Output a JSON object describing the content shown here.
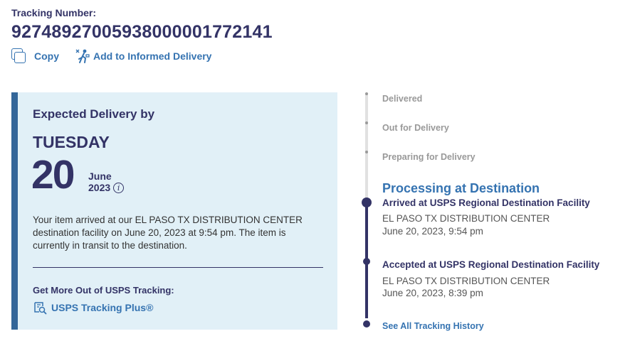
{
  "tracking": {
    "label": "Tracking Number:",
    "number": "92748927005938000001772141"
  },
  "actions": {
    "copy": "Copy",
    "informed": "Add to Informed Delivery"
  },
  "expected": {
    "title": "Expected Delivery by",
    "weekday": "TUESDAY",
    "day": "20",
    "month": "June",
    "year": "2023",
    "description": "Your item arrived at our EL PASO TX DISTRIBUTION CENTER destination facility on June 20, 2023 at 9:54 pm. The item is currently in transit to the destination.",
    "more_title": "Get More Out of USPS Tracking:",
    "plus_label": "USPS Tracking Plus",
    "plus_mark": "®"
  },
  "timeline": {
    "steps": [
      "Delivered",
      "Out for Delivery",
      "Preparing for Delivery"
    ],
    "current_status": "Processing at Destination",
    "events": [
      {
        "title": "Arrived at USPS Regional Destination Facility",
        "location": "EL PASO TX DISTRIBUTION CENTER",
        "date": "June 20, 2023, 9:54 pm"
      },
      {
        "title": "Accepted at USPS Regional Destination Facility",
        "location": "EL PASO TX DISTRIBUTION CENTER",
        "date": "June 20, 2023, 8:39 pm"
      }
    ],
    "history_link": "See All Tracking History"
  },
  "colors": {
    "navy": "#333366",
    "link_blue": "#3573b1",
    "card_bg": "#e1f0f7",
    "card_accent": "#336699",
    "muted": "#999999"
  },
  "icons": [
    "copy-icon",
    "informed-delivery-icon",
    "info-icon",
    "tracking-plus-icon"
  ]
}
